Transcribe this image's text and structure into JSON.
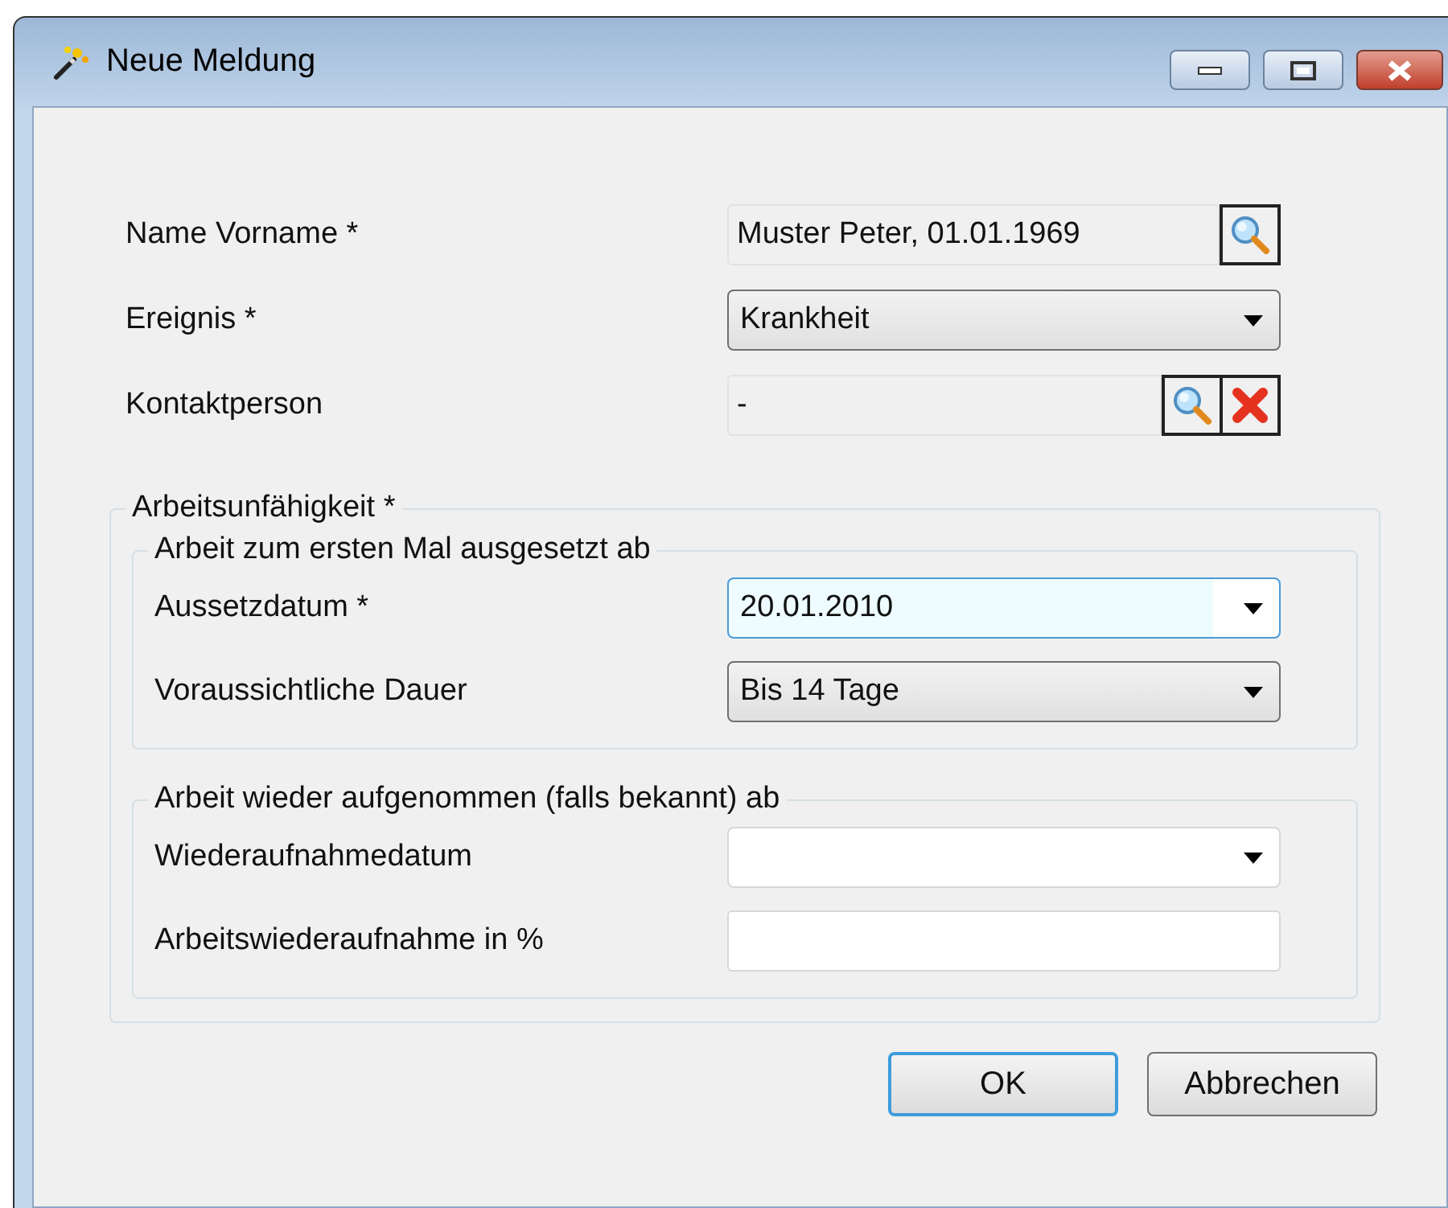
{
  "window": {
    "title": "Neue Meldung"
  },
  "fields": [
    {
      "label": "Name Vorname *",
      "kind": "lookup",
      "value": "Muster Peter, 01.01.1969",
      "buttons": [
        {
          "kind": "search"
        }
      ]
    },
    {
      "label": "Ereignis *",
      "kind": "dropdown",
      "value": "Krankheit"
    },
    {
      "label": "Kontaktperson",
      "kind": "lookup",
      "value": "-",
      "buttons": [
        {
          "kind": "search"
        },
        {
          "kind": "clear"
        }
      ]
    }
  ],
  "group": {
    "title": "Arbeitsunfähigkeit *",
    "sections": [
      {
        "title": "Arbeit zum ersten Mal ausgesetzt ab",
        "fields": [
          {
            "label": "Aussetzdatum *",
            "kind": "date",
            "value": "20.01.2010",
            "focused": true
          },
          {
            "label": "Voraussichtliche Dauer",
            "kind": "dropdown",
            "value": "Bis 14 Tage"
          }
        ]
      },
      {
        "title": "Arbeit wieder aufgenommen (falls bekannt) ab",
        "fields": [
          {
            "label": "Wiederaufnahmedatum",
            "kind": "date",
            "focused": false
          },
          {
            "label": "Arbeitswiederaufnahme in %",
            "kind": "text",
            "focused": false
          }
        ]
      }
    ]
  },
  "buttons": [
    {
      "label": "OK",
      "default": true
    },
    {
      "label": "Abbrechen",
      "default": false
    }
  ]
}
